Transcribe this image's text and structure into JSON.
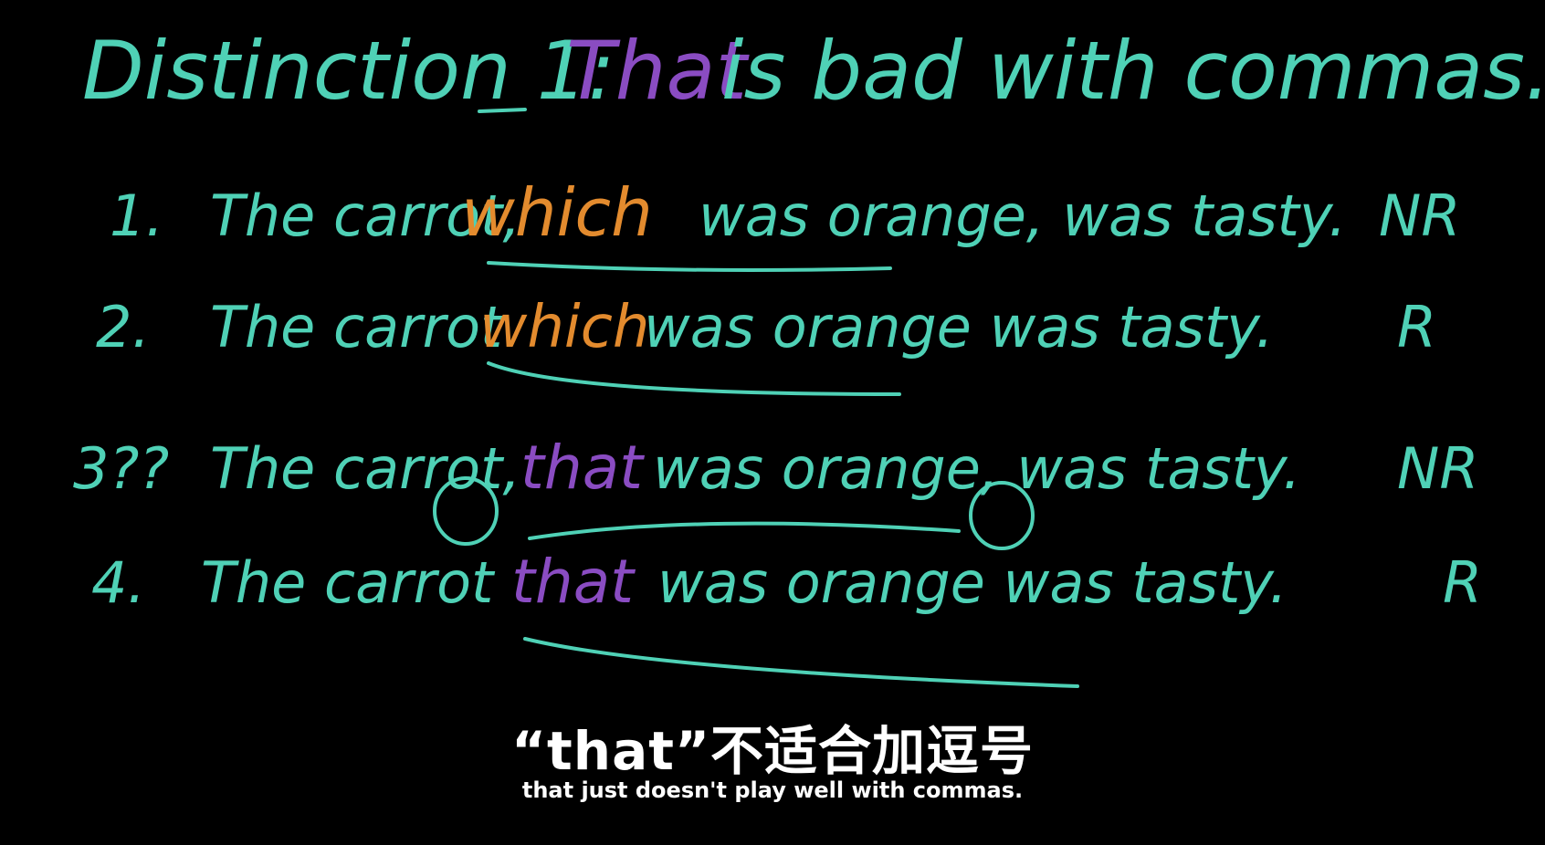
{
  "board": {
    "heading": {
      "prefix": "Distinction 1:",
      "keyword": "That",
      "rest": "is bad with commas."
    },
    "lines": [
      {
        "num": "1.",
        "before": "The carrot,",
        "keyword": "which",
        "after": "was orange, was tasty.",
        "tag": "NR"
      },
      {
        "num": "2.",
        "before": "The carrot",
        "keyword": "which",
        "after": "was orange was tasty.",
        "tag": "R"
      },
      {
        "num": "3??",
        "before": "The carrot,",
        "keyword": "that",
        "after": "was orange, was tasty.",
        "tag": "NR"
      },
      {
        "num": "4.",
        "before": "The carrot",
        "keyword": "that",
        "after": "was orange was tasty.",
        "tag": "R"
      }
    ]
  },
  "subtitles": {
    "chinese": "“that”不适合加逗号",
    "english": "that just doesn't play well with commas."
  },
  "colors": {
    "chalk_teal": "#4fd1b6",
    "which_orange": "#e38b2e",
    "that_purple": "#8a4cc2",
    "background": "#000000"
  }
}
